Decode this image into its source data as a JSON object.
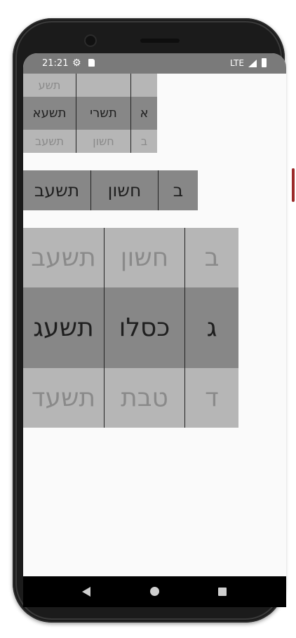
{
  "status_bar": {
    "time": "21:21",
    "network": "LTE",
    "icons": [
      "settings-icon",
      "sd-card-icon",
      "signal-icon",
      "battery-icon"
    ]
  },
  "pickers": [
    {
      "name": "picker-small",
      "columns": [
        {
          "name": "day",
          "above": "",
          "selected": "א",
          "below": "ב"
        },
        {
          "name": "month",
          "above": "",
          "selected": "תשרי",
          "below": "חשון"
        },
        {
          "name": "year",
          "above": "תשע",
          "selected": "תשעא",
          "below": "תשעב"
        }
      ]
    },
    {
      "name": "picker-medium",
      "columns": [
        {
          "name": "day",
          "selected": "ב"
        },
        {
          "name": "month",
          "selected": "חשון"
        },
        {
          "name": "year",
          "selected": "תשעב"
        }
      ]
    },
    {
      "name": "picker-large",
      "columns": [
        {
          "name": "day",
          "above": "ב",
          "selected": "ג",
          "below": "ד"
        },
        {
          "name": "month",
          "above": "חשון",
          "selected": "כסלו",
          "below": "טבת"
        },
        {
          "name": "year",
          "above": "תשעב",
          "selected": "תשעג",
          "below": "תשעד"
        }
      ]
    }
  ],
  "colors": {
    "status_bar": "#7a7a7a",
    "cell": "#b6b6b6",
    "cell_selected": "#878787",
    "screen_bg": "#fafafa"
  }
}
